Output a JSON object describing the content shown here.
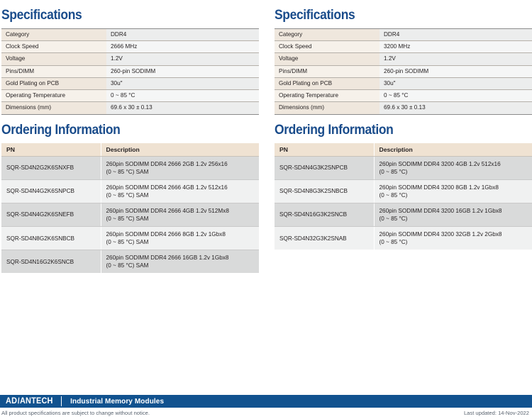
{
  "left": {
    "spec_title": "Specifications",
    "spec_rows": [
      {
        "key": "Category",
        "value": "DDR4"
      },
      {
        "key": "Clock Speed",
        "value": "2666 MHz"
      },
      {
        "key": "Voltage",
        "value": "1.2V"
      },
      {
        "key": "Pins/DIMM",
        "value": "260-pin SODIMM"
      },
      {
        "key": "Gold Plating on PCB",
        "value": "30u\""
      },
      {
        "key": "Operating Temperature",
        "value": "0 ~ 85 °C"
      },
      {
        "key": "Dimensions (mm)",
        "value": "69.6 x 30 ± 0.13"
      }
    ],
    "order_title": "Ordering Information",
    "order_headers": {
      "pn": "PN",
      "description": "Description"
    },
    "order_rows": [
      {
        "pn": "SQR-SD4N2G2K6SNXFB",
        "desc_line1": "260pin SODIMM DDR4 2666 2GB 1.2v 256x16",
        "desc_line2": "(0 ~ 85 °C) SAM"
      },
      {
        "pn": "SQR-SD4N4G2K6SNPCB",
        "desc_line1": "260pin SODIMM DDR4 2666 4GB 1.2v 512x16",
        "desc_line2": "(0 ~ 85 °C) SAM"
      },
      {
        "pn": "SQR-SD4N4G2K6SNEFB",
        "desc_line1": "260pin SODIMM DDR4 2666 4GB 1.2v 512Mx8",
        "desc_line2": "(0 ~ 85 °C) SAM"
      },
      {
        "pn": "SQR-SD4N8G2K6SNBCB",
        "desc_line1": "260pin SODIMM DDR4 2666 8GB 1.2v 1Gbx8",
        "desc_line2": "(0 ~ 85 °C) SAM"
      },
      {
        "pn": "SQR-SD4N16G2K6SNCB",
        "desc_line1": "260pin SODIMM DDR4 2666 16GB 1.2v 1Gbx8",
        "desc_line2": "(0 ~ 85 °C) SAM"
      }
    ]
  },
  "right": {
    "spec_title": "Specifications",
    "spec_rows": [
      {
        "key": "Category",
        "value": "DDR4"
      },
      {
        "key": "Clock Speed",
        "value": "3200 MHz"
      },
      {
        "key": "Voltage",
        "value": "1.2V"
      },
      {
        "key": "Pins/DIMM",
        "value": "260-pin SODIMM"
      },
      {
        "key": "Gold Plating on PCB",
        "value": "30u\""
      },
      {
        "key": "Operating Temperature",
        "value": "0 ~ 85 °C"
      },
      {
        "key": "Dimensions (mm)",
        "value": "69.6 x 30 ± 0.13"
      }
    ],
    "order_title": "Ordering Information",
    "order_headers": {
      "pn": "PN",
      "description": "Description"
    },
    "order_rows": [
      {
        "pn": "SQR-SD4N4G3K2SNPCB",
        "desc_line1": "260pin SODIMM DDR4 3200 4GB 1.2v 512x16",
        "desc_line2": "(0 ~ 85 °C)"
      },
      {
        "pn": "SQR-SD4N8G3K2SNBCB",
        "desc_line1": "260pin SODIMM DDR4 3200 8GB 1.2v 1Gbx8",
        "desc_line2": "(0 ~ 85 °C)"
      },
      {
        "pn": "SQR-SD4N16G3K2SNCB",
        "desc_line1": "260pin SODIMM DDR4 3200 16GB 1.2v 1Gbx8",
        "desc_line2": "(0 ~ 85 °C)"
      },
      {
        "pn": "SQR-SD4N32G3K2SNAB",
        "desc_line1": "260pin SODIMM DDR4 3200 32GB 1.2v 2Gbx8",
        "desc_line2": "(0 ~ 85 °C)"
      }
    ]
  },
  "footer": {
    "logo_pre": "AD",
    "logo_slash": "\\",
    "logo_post": "ANTECH",
    "bar_title": "Industrial Memory Modules",
    "disclaimer": "All product specifications are subject to change without notice.",
    "last_updated": "Last updated: 14-Nov-2022"
  },
  "colors": {
    "heading_blue": "#1a4c8b",
    "footer_blue": "#11528f",
    "spec_key_bg": "#efe7dd",
    "spec_value_bg": "#eceded",
    "order_header_bg": "#efe2d2",
    "order_row_odd": "#d9dada",
    "order_row_even": "#f0f1f1"
  }
}
